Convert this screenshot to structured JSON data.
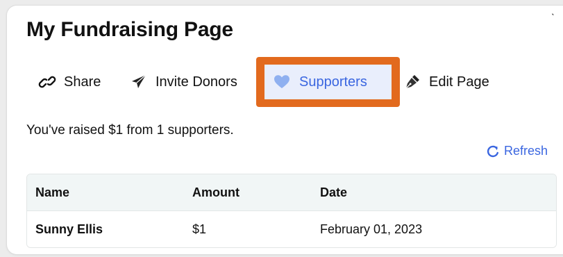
{
  "page": {
    "title": "My Fundraising Page",
    "corner_mark": "ˎ"
  },
  "tabs": [
    {
      "label": "Share",
      "icon": "link-icon"
    },
    {
      "label": "Invite Donors",
      "icon": "paper-plane-icon"
    },
    {
      "label": "Supporters",
      "icon": "heart-icon",
      "active": true
    },
    {
      "label": "Edit Page",
      "icon": "pen-icon"
    }
  ],
  "summary": {
    "prefix": "You've raised ",
    "amount": "$1",
    "middle": " from ",
    "count": "1",
    "suffix": " supporters."
  },
  "refresh": {
    "label": "Refresh",
    "icon": "refresh-icon"
  },
  "table": {
    "headers": [
      "Name",
      "Amount",
      "Date"
    ],
    "rows": [
      [
        "Sunny Ellis",
        "$1",
        "February 01, 2023"
      ]
    ]
  },
  "colors": {
    "accent": "#3a66e0",
    "highlight_border": "#e26a1e",
    "active_tab_bg": "#e9eefc",
    "table_header_bg": "#f1f6f6"
  }
}
